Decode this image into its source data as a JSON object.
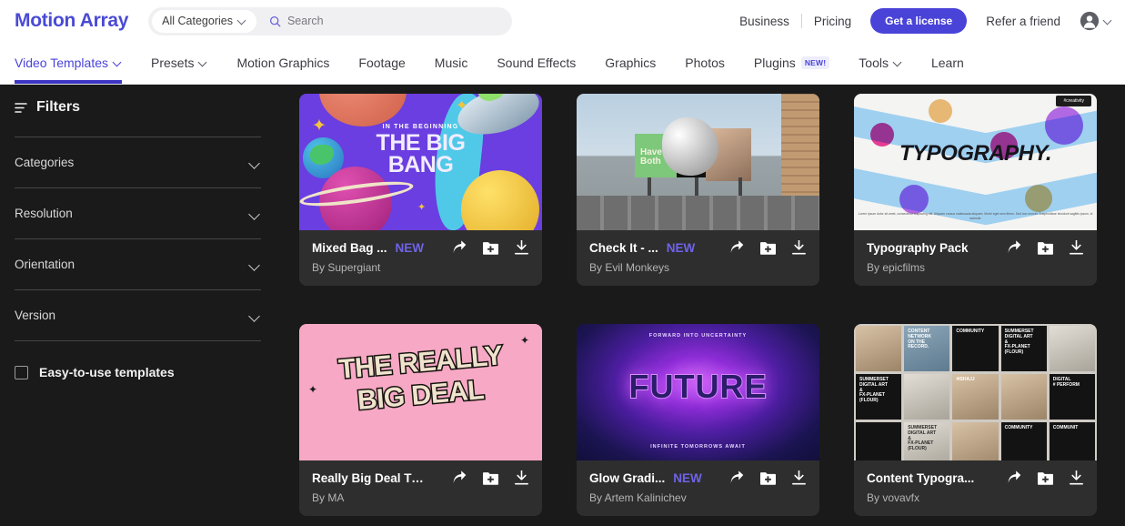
{
  "header": {
    "brand": "Motion Array",
    "category_select": "All Categories",
    "search_placeholder": "Search",
    "links": [
      {
        "label": "Business"
      },
      {
        "label": "Pricing"
      }
    ],
    "license_button": "Get a license",
    "refer_link": "Refer a friend"
  },
  "nav": {
    "items": [
      {
        "label": "Video Templates",
        "caret": true,
        "active": true,
        "badge": ""
      },
      {
        "label": "Presets",
        "caret": true,
        "active": false,
        "badge": ""
      },
      {
        "label": "Motion Graphics",
        "caret": false,
        "active": false,
        "badge": ""
      },
      {
        "label": "Footage",
        "caret": false,
        "active": false,
        "badge": ""
      },
      {
        "label": "Music",
        "caret": false,
        "active": false,
        "badge": ""
      },
      {
        "label": "Sound Effects",
        "caret": false,
        "active": false,
        "badge": ""
      },
      {
        "label": "Graphics",
        "caret": false,
        "active": false,
        "badge": ""
      },
      {
        "label": "Photos",
        "caret": false,
        "active": false,
        "badge": ""
      },
      {
        "label": "Plugins",
        "caret": false,
        "active": false,
        "badge": "NEW!"
      },
      {
        "label": "Tools",
        "caret": true,
        "active": false,
        "badge": ""
      },
      {
        "label": "Learn",
        "caret": false,
        "active": false,
        "badge": ""
      }
    ]
  },
  "sidebar": {
    "title": "Filters",
    "groups": [
      {
        "label": "Categories"
      },
      {
        "label": "Resolution"
      },
      {
        "label": "Orientation"
      },
      {
        "label": "Version"
      }
    ],
    "checkbox_label": "Easy-to-use templates",
    "checkbox_checked": false
  },
  "results": {
    "cards": [
      {
        "title": "Mixed Bag ...",
        "badge": "NEW",
        "author": "By Supergiant",
        "art": "big-bang",
        "art_text": {
          "kicker": "IN THE BEGINNING",
          "line1": "THE BIG",
          "line2": "BANG"
        }
      },
      {
        "title": "Check It - ...",
        "badge": "NEW",
        "author": "By Evil Monkeys",
        "art": "billboard",
        "art_text": {
          "line1": "Have",
          "line2": "Both"
        }
      },
      {
        "title": "Typography Pack",
        "badge": "",
        "author": "By epicfilms",
        "art": "typography",
        "art_text": {
          "main": "TYPOGRAPHY.",
          "corner": "#creativity",
          "fine": "Lorem ipsum dolor sit amet, consectetur adipiscing elit. Aliquam cursus malesuada aliquam. Morbi eget sem libero. Sed non nuncet. Suspendisse tincidunt sagittis ipsum, id molestie."
        }
      },
      {
        "title": "Really Big Deal Titl...",
        "badge": "",
        "author": "By MA",
        "art": "really-big-deal",
        "art_text": {
          "line1": "THE REALLY",
          "line2": "BIG DEAL"
        }
      },
      {
        "title": "Glow Gradi...",
        "badge": "NEW",
        "author": "By Artem Kalinichev",
        "art": "future-glow",
        "art_text": {
          "kicker": "FORWARD INTO UNCERTAINTY",
          "main": "FUTURE",
          "sub": "INFINITE TOMORROWS AWAIT"
        }
      },
      {
        "title": "Content Typogra...",
        "badge": "",
        "author": "By vovavfx",
        "art": "content-grid",
        "tiles": [
          "",
          "CONTENT\nNETWORK\nON THE\nRECORD.",
          "COMMUNITY",
          "SUMMERSET\nDIGITAL ART\n&\nFX-PLANET\n(FLOUR)",
          "",
          "SUMMERSET\nDIGITAL ART\n&\nFX-PLANET\n(FLOUR)",
          "",
          "#ISHAJJ",
          "",
          "DIGITAL\n# PERFORM",
          "",
          "SUMMERSET\nDIGITAL ART\n&\nFX-PLANET\n(FLOUR)",
          "",
          "COMMUNITY",
          "COMMUNIT"
        ]
      }
    ],
    "card_icons": {
      "share": "share-icon",
      "add": "add-to-folder-icon",
      "download": "download-icon"
    }
  },
  "colors": {
    "brand_purple": "#4a43d8",
    "badge_new": "#6f63e8",
    "page_bg": "#1a1a1a",
    "card_bg": "#2e2e2e"
  }
}
